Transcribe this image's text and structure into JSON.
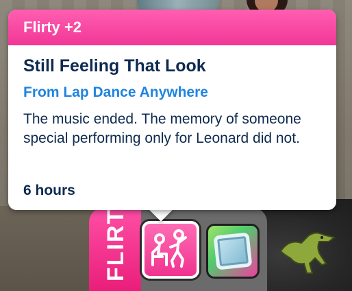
{
  "tooltip": {
    "header": "Flirty +2",
    "title": "Still Feeling That Look",
    "source": "From Lap Dance Anywhere",
    "description": "The music ended. The memory of someone special performing only for Leonard did not.",
    "duration": "6 hours"
  },
  "moodlet_panel": {
    "mood_label": "FLIRTY",
    "moodlets": [
      {
        "icon": "lap-dance-icon",
        "selected": true
      },
      {
        "icon": "picture-frame-icon",
        "selected": false
      }
    ]
  },
  "colors": {
    "flirty_pink": "#f13796",
    "title_navy": "#0e2a4f",
    "source_blue": "#1f84e0"
  }
}
